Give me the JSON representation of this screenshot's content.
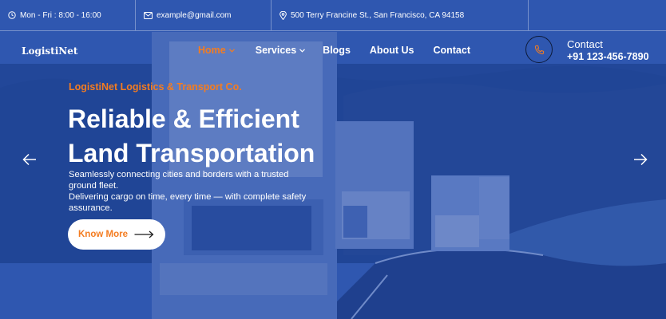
{
  "topbar": {
    "hours": "Mon - Fri : 8:00 - 16:00",
    "email": "example@gmail.com",
    "address": "500 Terry Francine St., San Francisco, CA 94158"
  },
  "header": {
    "logo": "LogistiNet",
    "nav": [
      {
        "label": "Home",
        "active": true,
        "dropdown": true
      },
      {
        "label": "Services",
        "active": false,
        "dropdown": true
      },
      {
        "label": "Blogs",
        "active": false,
        "dropdown": false
      },
      {
        "label": "About Us",
        "active": false,
        "dropdown": false
      },
      {
        "label": "Contact",
        "active": false,
        "dropdown": false
      }
    ],
    "contact_label": "Contact",
    "contact_phone": "+91 123-456-7890"
  },
  "hero": {
    "tagline": "LogistiNet Logistics & Transport Co.",
    "headline_line1": "Reliable & Efficient",
    "headline_line2": "Land Transportation",
    "description_line1": "Seamlessly connecting cities and borders with a trusted ground fleet.",
    "description_line2": "Delivering cargo on time, every time — with complete safety assurance.",
    "cta_label": "Know More"
  },
  "icons": {
    "clock": "clock-icon",
    "mail": "mail-icon",
    "location": "location-pin-icon",
    "phone": "phone-icon",
    "prev": "arrow-left-icon",
    "next": "arrow-right-icon"
  },
  "colors": {
    "accent": "#f47c20",
    "overlay": "#2d53a6",
    "text": "#ffffff"
  }
}
